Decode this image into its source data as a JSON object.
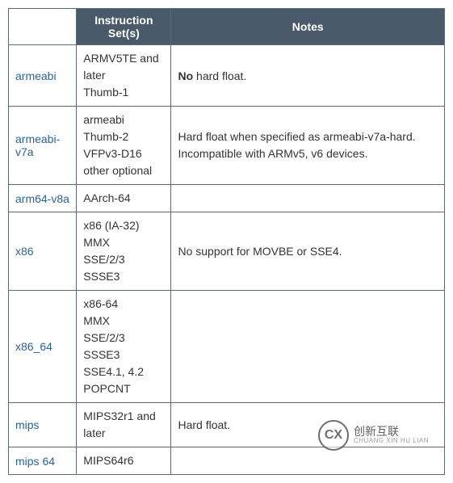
{
  "headers": {
    "col_instruction": "Instruction Set(s)",
    "col_notes": "Notes"
  },
  "rows": [
    {
      "abi": "armeabi",
      "instructions": [
        "ARMV5TE and later",
        "Thumb-1"
      ],
      "notes_bold": "No",
      "notes_rest": " hard float."
    },
    {
      "abi": "armeabi-v7a",
      "instructions": [
        "armeabi",
        "Thumb-2",
        "VFPv3-D16",
        "other optional"
      ],
      "notes": "Hard float when specified as armeabi-v7a-hard. Incompatible with ARMv5, v6 devices."
    },
    {
      "abi": "arm64-v8a",
      "instructions": [
        "AArch-64"
      ],
      "notes": ""
    },
    {
      "abi": "x86",
      "instructions": [
        "x86 (IA-32)",
        "MMX",
        "SSE/2/3",
        "SSSE3"
      ],
      "notes": "No support for MOVBE or SSE4."
    },
    {
      "abi": "x86_64",
      "instructions": [
        "x86-64",
        "MMX",
        "SSE/2/3",
        "SSSE3",
        "SSE4.1, 4.2",
        "POPCNT"
      ],
      "notes": ""
    },
    {
      "abi": "mips",
      "instructions": [
        "MIPS32r1 and later"
      ],
      "notes": "Hard float."
    },
    {
      "abi": "mips 64",
      "instructions": [
        "MIPS64r6"
      ],
      "notes": ""
    }
  ],
  "watermark": {
    "logo_text": "CX",
    "cn": "创新互联",
    "en": "CHUANG XIN HU LIAN"
  }
}
